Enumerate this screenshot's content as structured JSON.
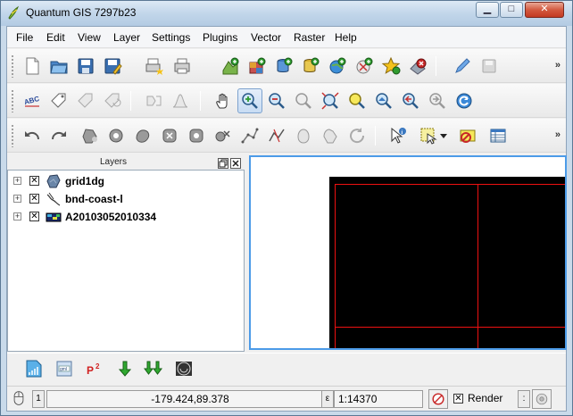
{
  "window": {
    "title": "Quantum GIS 7297b23"
  },
  "menu": [
    "File",
    "Edit",
    "View",
    "Layer",
    "Settings",
    "Plugins",
    "Vector",
    "Raster",
    "Help"
  ],
  "toolbar": {
    "overflow": "»"
  },
  "layers_panel": {
    "title": "Layers",
    "layers": [
      {
        "name": "grid1dg",
        "checked": "✕",
        "expander": "+",
        "icon": "polygon-layer-icon"
      },
      {
        "name": "bnd-coast-l",
        "checked": "✕",
        "expander": "+",
        "icon": "line-layer-icon"
      },
      {
        "name": "A20103052010334",
        "checked": "✕",
        "expander": "+",
        "icon": "raster-layer-icon"
      }
    ]
  },
  "map": {
    "background": "#000000",
    "grid_color": "#e01010"
  },
  "statusbar": {
    "coord_label": "1",
    "coordinates": "-179.424,89.378",
    "scale_label": "ε",
    "scale": "1:14370",
    "render_label": "Render",
    "render_checked": "✕"
  },
  "colors": {
    "accent": "#4c9be8",
    "window_frame": "#c9daea"
  }
}
